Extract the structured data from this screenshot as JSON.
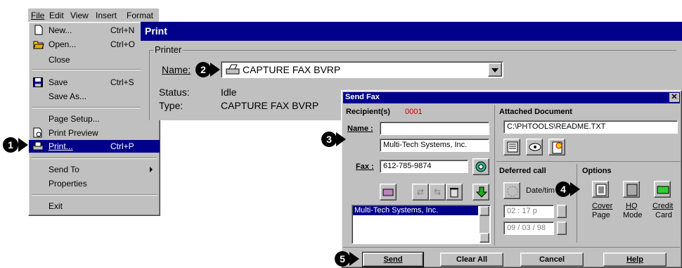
{
  "menubar": {
    "items": [
      "File",
      "Edit",
      "View",
      "Insert",
      "Format"
    ]
  },
  "file_menu": {
    "items": [
      {
        "label": "New...",
        "shortcut": "Ctrl+N",
        "icon": "new-doc-icon"
      },
      {
        "label": "Open...",
        "shortcut": "Ctrl+O",
        "icon": "open-folder-icon"
      },
      {
        "label": "Close",
        "shortcut": ""
      },
      {
        "label": "Save",
        "shortcut": "Ctrl+S",
        "icon": "floppy-disk-icon"
      },
      {
        "label": "Save As...",
        "shortcut": ""
      },
      {
        "label": "Page Setup...",
        "shortcut": ""
      },
      {
        "label": "Print Preview",
        "shortcut": "",
        "icon": "print-preview-icon"
      },
      {
        "label": "Print...",
        "shortcut": "Ctrl+P",
        "icon": "printer-icon"
      },
      {
        "label": "Send To",
        "shortcut": ""
      },
      {
        "label": "Properties",
        "shortcut": ""
      },
      {
        "label": "Exit",
        "shortcut": ""
      }
    ]
  },
  "print_dialog": {
    "title": "Print",
    "group_label": "Printer",
    "name_label": "Name:",
    "printer_name": "CAPTURE FAX BVRP",
    "status_label": "Status:",
    "status_value": "Idle",
    "type_label": "Type:",
    "type_value": "CAPTURE FAX BVRP"
  },
  "send_fax": {
    "title": "Send Fax",
    "recipients_label": "Recipient(s)",
    "recipients_count": "0001",
    "name_label": "Name :",
    "name_value": "",
    "company_value": "Multi-Tech Systems, Inc.",
    "fax_label": "Fax :",
    "fax_value": "612-785-9874",
    "recipient_list": [
      "Multi-Tech Systems, Inc."
    ],
    "attached_label": "Attached Document",
    "attached_path": "C:\\PHTOOLS\\README.TXT",
    "deferred_label": "Deferred call",
    "datetime_label": "Date/tim",
    "time_value": "02 : 17  p",
    "date_value": "09 / 03 / 98",
    "options_label": "Options",
    "options": [
      {
        "line1": "Cover",
        "line2": "Page"
      },
      {
        "line1": "HQ",
        "line2": "Mode"
      },
      {
        "line1": "Credit",
        "line2": "Card"
      }
    ],
    "buttons": {
      "send": "Send",
      "clear_all": "Clear All",
      "cancel": "Cancel",
      "help": "Help"
    }
  },
  "callouts": [
    "1",
    "2",
    "3",
    "4",
    "5"
  ],
  "colors": {
    "titlebar": "#00008b",
    "menu_bg": "#c0c0c0",
    "highlight": "#00008b",
    "count_red": "#c00000"
  }
}
